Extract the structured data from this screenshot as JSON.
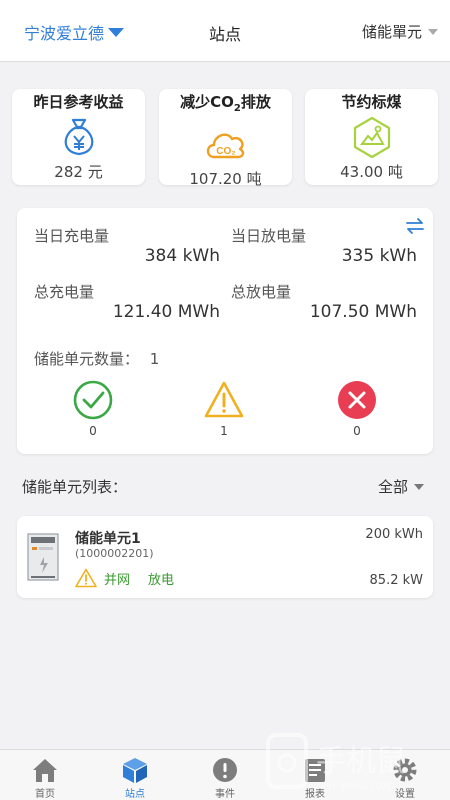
{
  "header": {
    "site_name": "宁波爱立德",
    "title": "站点",
    "unit_select": "储能單元"
  },
  "stats": [
    {
      "label_pre": "昨日参考收益",
      "label_sub": "",
      "label_post": "",
      "value": "282 元"
    },
    {
      "label_pre": "减少CO",
      "label_sub": "2",
      "label_post": "排放",
      "value": "107.20 吨"
    },
    {
      "label_pre": "节约标煤",
      "label_sub": "",
      "label_post": "",
      "value": "43.00 吨"
    }
  ],
  "energy": {
    "daily_charge_label": "当日充电量",
    "daily_charge_value": "384 kWh",
    "daily_discharge_label": "当日放电量",
    "daily_discharge_value": "335 kWh",
    "total_charge_label": "总充电量",
    "total_charge_value": "121.40 MWh",
    "total_discharge_label": "总放电量",
    "total_discharge_value": "107.50 MWh",
    "unit_count_label": "储能单元数量：",
    "unit_count": "1",
    "status": {
      "normal": "0",
      "warning": "1",
      "fault": "0"
    }
  },
  "list": {
    "title": "储能单元列表：",
    "filter": "全部",
    "items": [
      {
        "name": "储能单元1",
        "id": "(1000002201)",
        "grid_status": "并网",
        "mode": "放电",
        "capacity": "200 kWh",
        "power": "85.2 kW"
      }
    ]
  },
  "tabs": [
    {
      "label": "首页",
      "icon": "home-icon"
    },
    {
      "label": "站点",
      "icon": "cube-icon",
      "active": true
    },
    {
      "label": "事件",
      "icon": "alert-icon"
    },
    {
      "label": "报表",
      "icon": "report-icon"
    },
    {
      "label": "设置",
      "icon": "gear-icon"
    }
  ],
  "watermark": {
    "text": "手机鼠",
    "sub": "SHOUJISHU.COM"
  },
  "colors": {
    "accent": "#2f7ed8",
    "green": "#3a9a30",
    "orange": "#f0a020",
    "red": "#e83d52",
    "lime": "#a6d23c"
  }
}
